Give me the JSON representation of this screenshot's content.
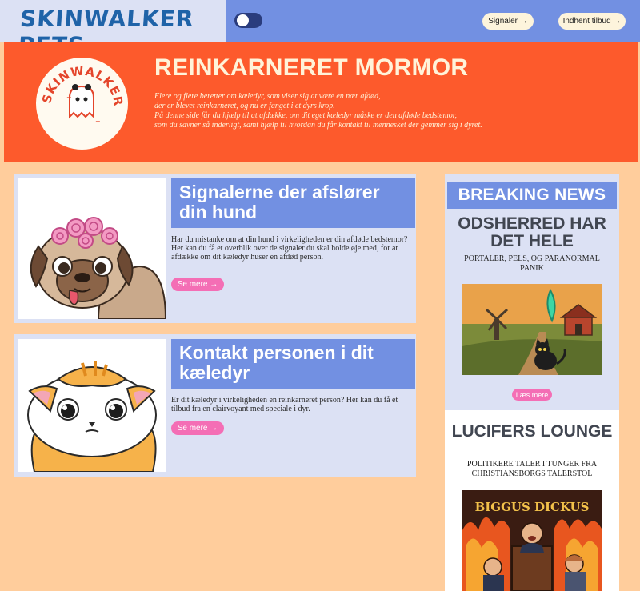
{
  "header": {
    "logo_text": "SKINWALKER PETS",
    "nav": [
      {
        "label": "Signaler →"
      },
      {
        "label": "Indhent tilbud →"
      }
    ]
  },
  "hero": {
    "logo_text": "SKINWALKER PETS",
    "title": "REINKARNERET MORMOR",
    "description_lines": [
      "Flere og flere beretter om kæledyr, som viser sig at være en nær afdød,",
      "der er blevet reinkarneret, og nu er fanget i et dyrs krop.",
      "På denne side får du hjælp til at afdække, om dit eget kæledyr måske er den afdøde bedstemor,",
      "som du savner så inderligt, samt hjælp til hvordan du får kontakt til mennesket der gemmer sig i dyret."
    ]
  },
  "articles": [
    {
      "title": "Signalerne der afslører din hund",
      "text": "Har du mistanke om at din hund i virkeligheden er din afdøde bedstemor? Her kan du få et overblik over de signaler du skal holde øje med, for at afdække om dit kæledyr huser en afdød person.",
      "button": "Se mere →"
    },
    {
      "title": "Kontakt personen i dit kæledyr",
      "text": "Er dit kæledyr i virkeligheden en reinkarneret person? Her kan du få et tilbud fra en clairvoyant med speciale i dyr.",
      "button": "Se mere →"
    }
  ],
  "news": {
    "heading": "BREAKING NEWS",
    "stories": [
      {
        "title": "ODSHERRED HAR DET HELE",
        "subtitle": "PORTALER, PELS, OG PARANORMAL PANIK",
        "button": "Læs mere"
      },
      {
        "title": "LUCIFERS LOUNGE",
        "subtitle": "POLITIKERE TALER I TUNGER FRA CHRISTIANSBORGS TALERSTOL",
        "image_text": "BIGGUS DICKUS"
      }
    ]
  },
  "colors": {
    "page_bg": "#ffcd9c",
    "nav_blue": "#7290e2",
    "hero_orange": "#fd5a2c",
    "card_bg": "#dce1f4",
    "button_pink": "#f46eb5"
  }
}
